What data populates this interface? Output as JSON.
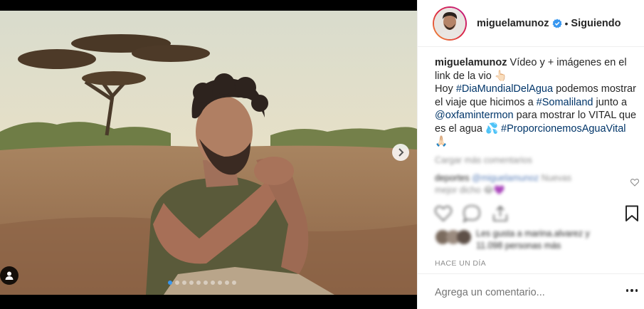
{
  "post": {
    "username": "miguelamunoz",
    "bullet": "•",
    "follow_state": "Siguiendo",
    "caption": {
      "username": "miguelamunoz",
      "part1": " Vídeo y + imágenes en el link de la vio ",
      "emoji_point": "👆🏻",
      "part2": "Hoy ",
      "hashtag_dia": "#DiaMundialDelAgua",
      "part3": " podemos mostrar el viaje que hicimos a ",
      "hashtag_somaliland": "#Somaliland",
      "part4": " junto a ",
      "mention_oxfam": "@oxfamintermon",
      "part5": " para mostrar lo VITAL que es el agua ",
      "emoji_drops": "💦",
      "hashtag_proporcionemos": "#ProporcionemosAguaVital",
      "emoji_pray": "🙏🏻"
    },
    "blurred": {
      "load_more": "Cargar más comentarios",
      "comment_user": "deportes",
      "comment_mention": "@miguelamunoz",
      "comment_text": "Nuevas",
      "comment_text2": "mejor dicho 😂💜",
      "likes_line1": "Les gusta a marina.alvarez y",
      "likes_line2": "11.098 personas más"
    },
    "timestamp": "HACE UN DÍA",
    "comment_placeholder": "Agrega un comentario...",
    "carousel": {
      "count": 10,
      "active_index": 0
    }
  },
  "colors": {
    "accent": "#3897f0",
    "link": "#003569",
    "muted": "#8e8e8e",
    "text": "#262626"
  },
  "icons": {
    "verified": "verified-badge-icon",
    "next": "chevron-right-icon",
    "user_tag": "user-tag-icon",
    "heart": "heart-icon",
    "bookmark": "bookmark-icon",
    "more": "more-options-icon"
  }
}
